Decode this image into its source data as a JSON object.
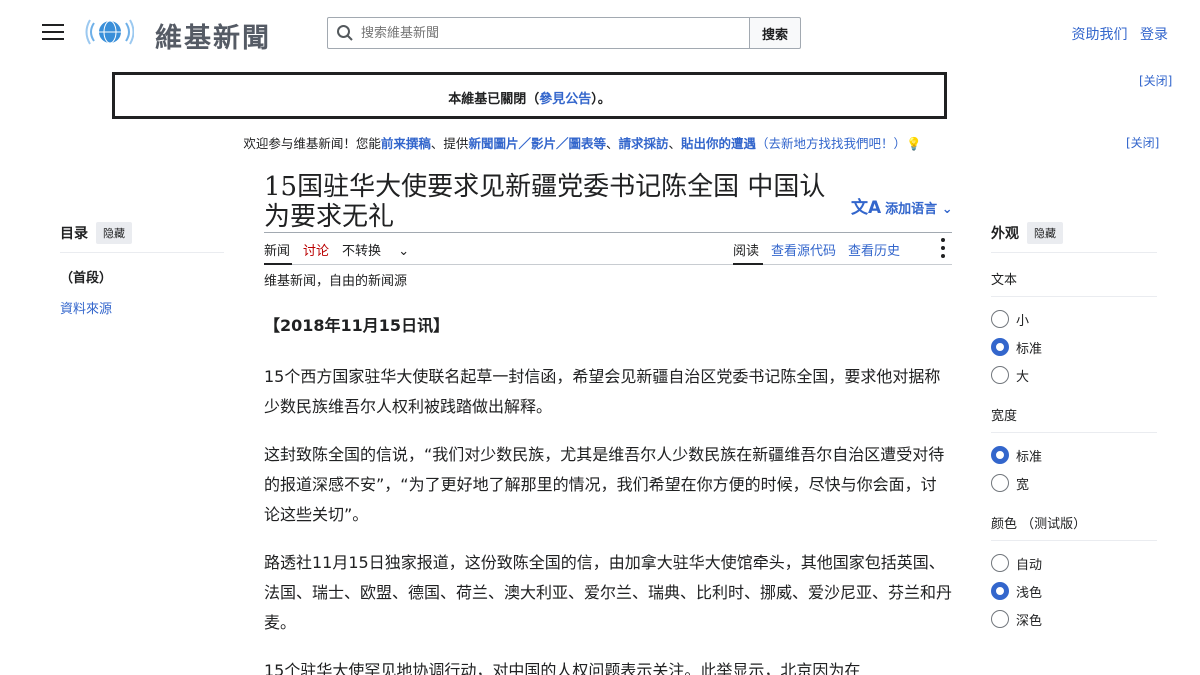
{
  "header": {
    "logo_text": "維基新聞",
    "search_placeholder": "搜索維基新聞",
    "search_button": "搜索",
    "donate": "资助我们",
    "login": "登录"
  },
  "notice": {
    "prefix": "本維基已關閉（",
    "link": "參見公告",
    "suffix": "）。",
    "dismiss": "[关闭]"
  },
  "welcome": {
    "t1": "欢迎参与维基新闻！您能",
    "l1": "前来撰稿",
    "t2": "、提供",
    "l2": "新聞圖片／影片／圖表等",
    "t3": "、",
    "l3": "請求採訪",
    "t4": "、",
    "l4": "貼出你的遭遇",
    "l5": "（去新地方找找我們吧！）",
    "emoji": "💡",
    "dismiss": "[关闭]"
  },
  "article": {
    "title": "15国驻华大使要求见新疆党委书记陈全国 中国认为要求无礼",
    "add_languages": "添加语言",
    "tabs_left": [
      "新闻",
      "讨论",
      "不转换"
    ],
    "tabs_right": [
      "阅读",
      "查看源代码",
      "查看历史"
    ],
    "tagline": "维基新闻，自由的新闻源",
    "dateline": "【2018年11月15日讯】",
    "paragraphs": [
      "15个西方国家驻华大使联名起草一封信函，希望会见新疆自治区党委书记陈全国，要求他对据称少数民族维吾尔人权利被践踏做出解释。",
      "这封致陈全国的信说，“我们对少数民族，尤其是维吾尔人少数民族在新疆维吾尔自治区遭受对待的报道深感不安”，“为了更好地了解那里的情况，我们希望在你方便的时候，尽快与你会面，讨论这些关切”。",
      "路透社11月15日独家报道，这份致陈全国的信，由加拿大驻华大使馆牵头，其他国家包括英国、法国、瑞士、欧盟、德国、荷兰、澳大利亚、爱尔兰、瑞典、比利时、挪威、爱沙尼亚、芬兰和丹麦。",
      "15个驻华大使罕见地协调行动，对中国的人权问题表示关注。此举显示，北京因为在"
    ]
  },
  "toc": {
    "title": "目录",
    "hide": "隐藏",
    "items": [
      "（首段）",
      "資料來源"
    ]
  },
  "appearance": {
    "title": "外观",
    "hide": "隐藏",
    "text_label": "文本",
    "text_options": [
      "小",
      "标准",
      "大"
    ],
    "width_label": "宽度",
    "width_options": [
      "标准",
      "宽"
    ],
    "color_label": "颜色 （测试版）",
    "color_options": [
      "自动",
      "浅色",
      "深色"
    ]
  },
  "colors": {
    "link": "#3366cc",
    "talk": "#ba0000",
    "text": "#202122"
  }
}
